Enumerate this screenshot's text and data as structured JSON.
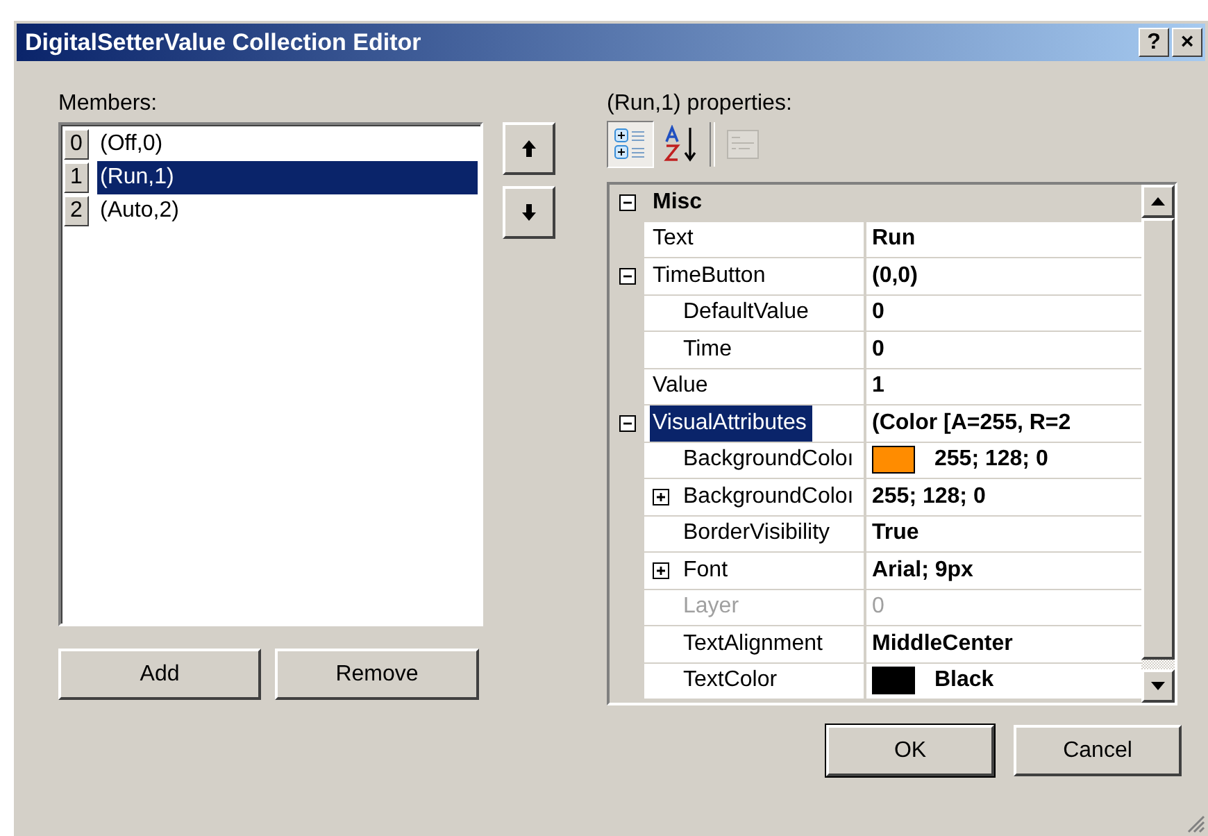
{
  "window": {
    "title": "DigitalSetterValue Collection Editor",
    "help_button": "?",
    "close_button": "×"
  },
  "members": {
    "label": "Members:",
    "items": [
      {
        "index": "0",
        "text": "(Off,0)",
        "selected": false
      },
      {
        "index": "1",
        "text": "(Run,1)",
        "selected": true
      },
      {
        "index": "2",
        "text": "(Auto,2)",
        "selected": false
      }
    ],
    "buttons": [
      "Add",
      "Remove"
    ]
  },
  "properties": {
    "label": "(Run,1) properties:",
    "toolbar": [
      {
        "kind": "categorized",
        "selected": true,
        "disabled": false
      },
      {
        "kind": "alphabetical",
        "selected": false,
        "disabled": false
      },
      {
        "kind": "property-pages",
        "selected": false,
        "disabled": true
      }
    ],
    "rows": [
      {
        "kind": "category",
        "name": "Misc",
        "expanded": true,
        "children": [
          {
            "kind": "property",
            "name": "Text",
            "value": "Run",
            "modified": true,
            "selected": false,
            "disabled": false
          },
          {
            "kind": "property",
            "name": "TimeButton",
            "value": "(0,0)",
            "modified": true,
            "selected": false,
            "disabled": false,
            "expanded": true,
            "children": [
              {
                "kind": "property",
                "name": "DefaultValue",
                "value": "0",
                "modified": true,
                "selected": false,
                "disabled": false
              },
              {
                "kind": "property",
                "name": "Time",
                "value": "0",
                "modified": true,
                "selected": false,
                "disabled": false
              }
            ]
          },
          {
            "kind": "property",
            "name": "Value",
            "value": "1",
            "modified": true,
            "selected": false,
            "disabled": false
          },
          {
            "kind": "property",
            "name": "VisualAttributes",
            "value": "(Color [A=255, R=2",
            "modified": true,
            "selected": true,
            "disabled": false,
            "expanded": true,
            "children": [
              {
                "kind": "property",
                "name": "BackgroundColoı",
                "value": "255; 128; 0",
                "modified": true,
                "selected": false,
                "disabled": false,
                "color": "#ff8c00"
              },
              {
                "kind": "property",
                "name": "BackgroundColoı",
                "value": "255; 128; 0",
                "modified": true,
                "selected": false,
                "disabled": false,
                "expanded": false
              },
              {
                "kind": "property",
                "name": "BorderVisibility",
                "value": "True",
                "modified": true,
                "selected": false,
                "disabled": false
              },
              {
                "kind": "property",
                "name": "Font",
                "value": "Arial; 9px",
                "modified": true,
                "selected": false,
                "disabled": false,
                "expanded": false
              },
              {
                "kind": "property",
                "name": "Layer",
                "value": "0",
                "modified": false,
                "selected": false,
                "disabled": true
              },
              {
                "kind": "property",
                "name": "TextAlignment",
                "value": "MiddleCenter",
                "modified": true,
                "selected": false,
                "disabled": false
              },
              {
                "kind": "property",
                "name": "TextColor",
                "value": "Black",
                "modified": true,
                "selected": false,
                "disabled": false,
                "color": "#000000"
              }
            ]
          }
        ]
      }
    ]
  },
  "dialog_buttons": [
    {
      "label": "OK",
      "default": true
    },
    {
      "label": "Cancel",
      "default": false
    }
  ]
}
